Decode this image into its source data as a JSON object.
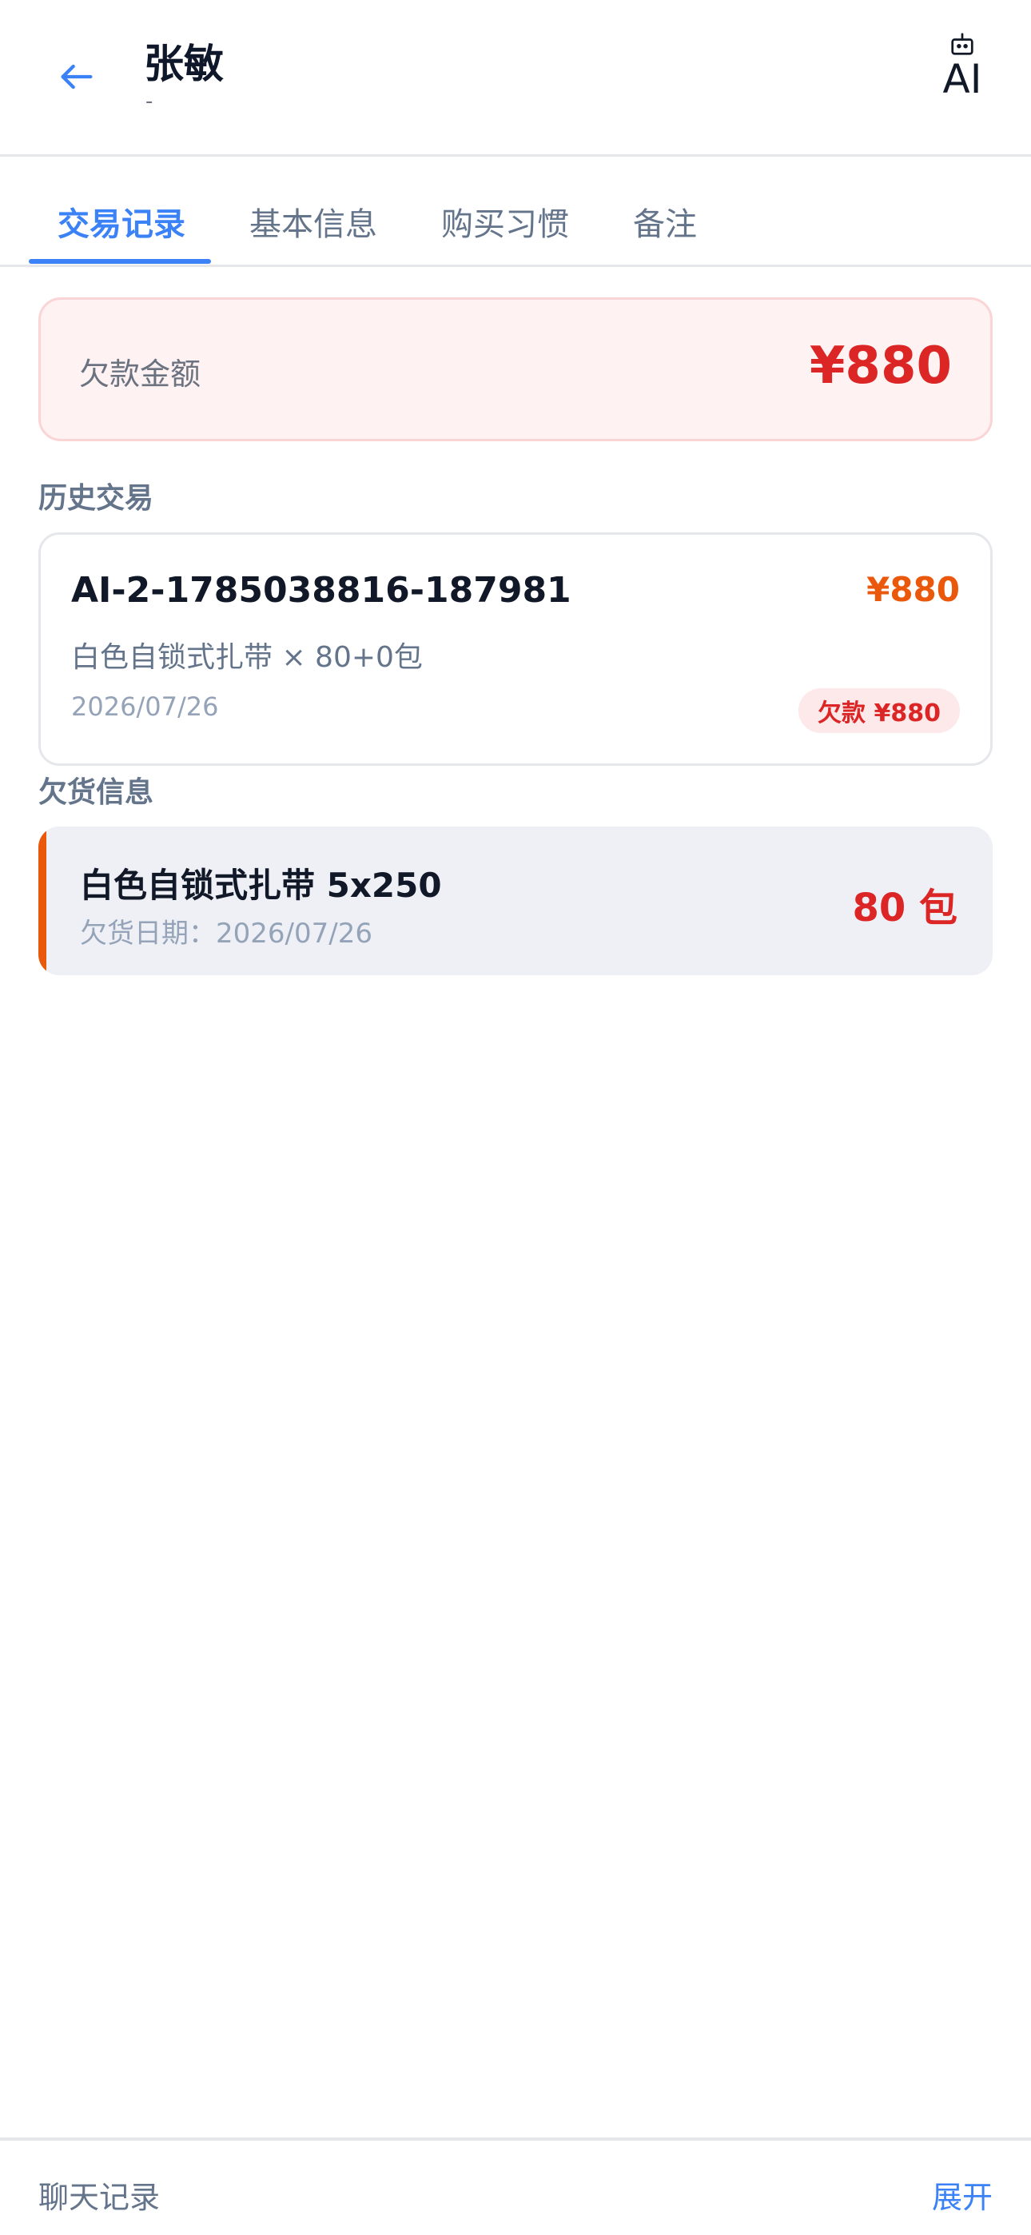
{
  "header": {
    "title": "张敏",
    "subtitle": "-",
    "ai_label": "AI"
  },
  "tabs": [
    {
      "label": "交易记录",
      "active": true
    },
    {
      "label": "基本信息",
      "active": false
    },
    {
      "label": "购买习惯",
      "active": false
    },
    {
      "label": "备注",
      "active": false
    }
  ],
  "debt": {
    "label": "欠款金额",
    "value": "¥880"
  },
  "history": {
    "section_title": "历史交易",
    "transactions": [
      {
        "id": "AI-2-1785038816-187981",
        "amount": "¥880",
        "items": "白色自锁式扎带 × 80+0包",
        "date": "2026/07/26",
        "badge": "欠款 ¥880"
      }
    ]
  },
  "owed_goods": {
    "section_title": "欠货信息",
    "items": [
      {
        "name": "白色自锁式扎带 5x250",
        "date": "欠货日期：2026/07/26",
        "quantity": "80 包"
      }
    ]
  },
  "footer": {
    "label": "聊天记录",
    "expand": "展开"
  },
  "colors": {
    "accent": "#3b82f6",
    "debt_red": "#dc2626",
    "amount_orange": "#ea580c"
  },
  "icons": {
    "back": "arrow-left-icon",
    "ai": "robot-icon"
  }
}
